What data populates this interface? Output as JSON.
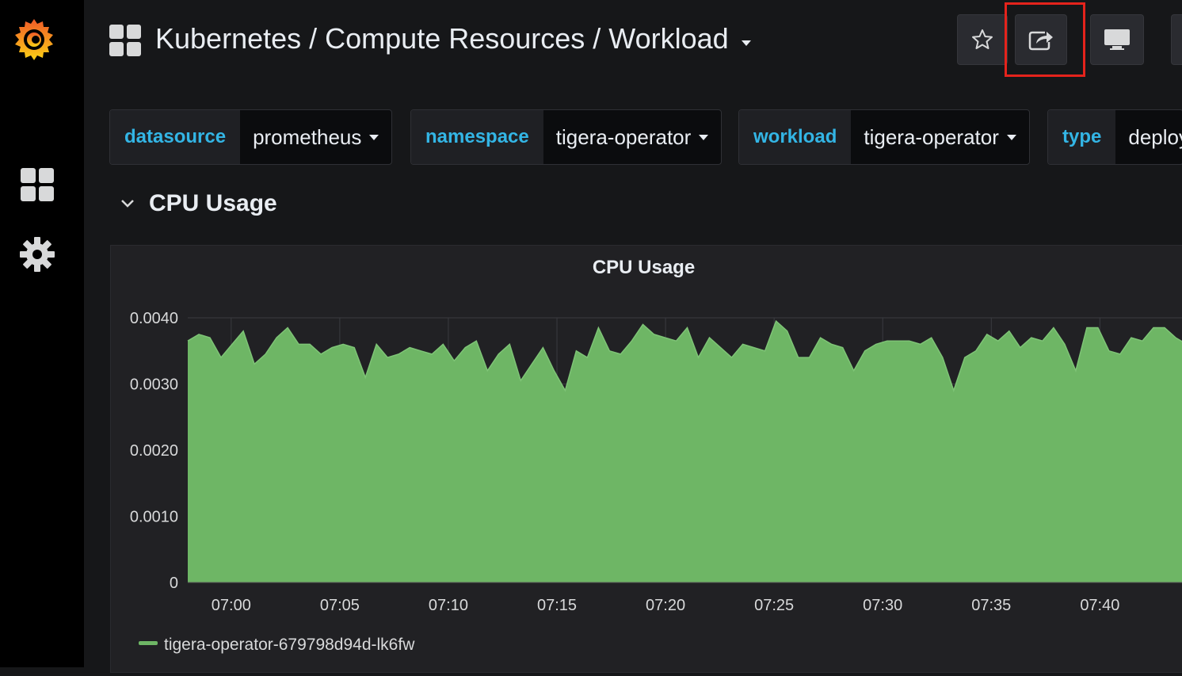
{
  "header": {
    "title": "Kubernetes / Compute Resources / Workload"
  },
  "toolbar": {
    "star_icon": "star-icon",
    "share_icon": "share-icon",
    "tv_icon": "tv-mode-icon"
  },
  "variables": [
    {
      "label": "datasource",
      "value": "prometheus"
    },
    {
      "label": "namespace",
      "value": "tigera-operator"
    },
    {
      "label": "workload",
      "value": "tigera-operator"
    },
    {
      "label": "type",
      "value": "deploy"
    }
  ],
  "row": {
    "title": "CPU Usage"
  },
  "colors": {
    "series": "#6eb665",
    "accent_label": "#33b5e5",
    "highlight": "#e5231c"
  },
  "chart_data": {
    "type": "area",
    "title": "CPU Usage",
    "xlabel": "",
    "ylabel": "",
    "ylim": [
      0,
      0.004
    ],
    "yticks": [
      "0",
      "0.0010",
      "0.0020",
      "0.0030",
      "0.0040"
    ],
    "xticks": [
      "07:00",
      "07:05",
      "07:10",
      "07:15",
      "07:20",
      "07:25",
      "07:30",
      "07:35",
      "07:40"
    ],
    "x_start": "06:58",
    "x_end": "07:44",
    "grid": true,
    "legend": "bottom-left",
    "series": [
      {
        "name": "tigera-operator-679798d94d-lk6fw",
        "values": [
          0.00365,
          0.00375,
          0.0037,
          0.0034,
          0.0036,
          0.0038,
          0.0033,
          0.00345,
          0.0037,
          0.00385,
          0.0036,
          0.0036,
          0.00345,
          0.00355,
          0.0036,
          0.00355,
          0.0031,
          0.0036,
          0.0034,
          0.00345,
          0.00355,
          0.0035,
          0.00345,
          0.0036,
          0.00335,
          0.00355,
          0.00365,
          0.0032,
          0.00345,
          0.0036,
          0.00305,
          0.0033,
          0.00355,
          0.0032,
          0.0029,
          0.0035,
          0.0034,
          0.00385,
          0.0035,
          0.00345,
          0.00365,
          0.0039,
          0.00375,
          0.0037,
          0.00365,
          0.00385,
          0.0034,
          0.0037,
          0.00355,
          0.0034,
          0.0036,
          0.00355,
          0.0035,
          0.00395,
          0.0038,
          0.0034,
          0.0034,
          0.0037,
          0.0036,
          0.00355,
          0.0032,
          0.0035,
          0.0036,
          0.00365,
          0.00365,
          0.00365,
          0.0036,
          0.0037,
          0.0034,
          0.0029,
          0.0034,
          0.0035,
          0.00375,
          0.00365,
          0.0038,
          0.00355,
          0.0037,
          0.00365,
          0.00385,
          0.0036,
          0.0032,
          0.00385,
          0.00385,
          0.0035,
          0.00345,
          0.0037,
          0.00365,
          0.00385,
          0.00385,
          0.0037,
          0.0036
        ]
      }
    ]
  }
}
